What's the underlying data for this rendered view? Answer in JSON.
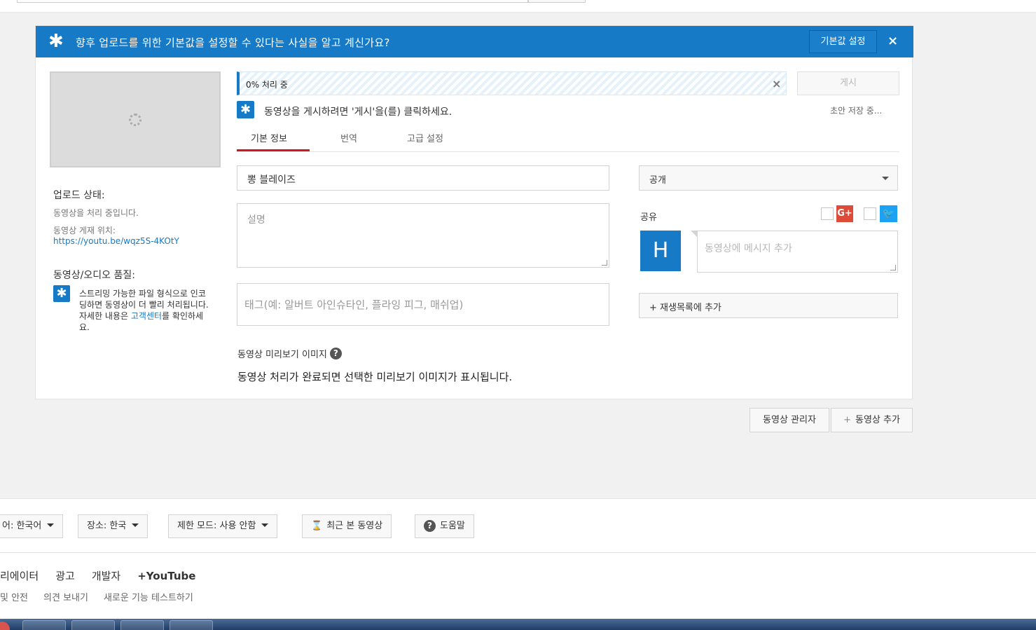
{
  "banner": {
    "text": "향후 업로드를 위한 기본값을 설정할 수 있다는 사실을 알고 계신가요?",
    "settings_button": "기본값 설정",
    "close": "×"
  },
  "left": {
    "status_heading": "업로드 상태:",
    "status_text": "동영상을 처리 중입니다.",
    "location_label": "동영상 게재 위치:",
    "location_url": "https://youtu.be/wqz5S-4KOtY",
    "quality_heading": "동영상/오디오 품질:",
    "quality_text_1": "스트리밍 가능한 파일 형식으로 인코딩하면 동영상이 더 빨리 처리됩니다. 자세한 내용은 ",
    "quality_link": "고객센터",
    "quality_text_2": "를 확인하세요."
  },
  "upload": {
    "progress_text": "0% 처리 중",
    "progress_percent": 0,
    "cancel": "×",
    "publish_button": "게시",
    "publish_hint": "동영상을 게시하려면 '게시'을(를) 클릭하세요.",
    "draft_status": "초안 저장 중..."
  },
  "tabs": [
    {
      "label": "기본 정보",
      "active": true
    },
    {
      "label": "번역",
      "active": false
    },
    {
      "label": "고급 설정",
      "active": false
    }
  ],
  "form": {
    "title_value": "뽕 블레이즈",
    "description_placeholder": "설명",
    "tags_placeholder": "태그(예: 알버트 아인슈타인, 플라잉 피그, 매쉬업)",
    "preview_label": "동영상 미리보기 이미지",
    "preview_help": "?",
    "preview_message": "동영상 처리가 완료되면 선택한 미리보기 이미지가 표시됩니다."
  },
  "share": {
    "visibility": "공개",
    "label": "공유",
    "gplus": "G+",
    "avatar_letter": "H",
    "message_placeholder": "동영상에 메시지 추가",
    "playlist_button": "+ 재생목록에 추가"
  },
  "actions": {
    "manager_button": "동영상 관리자",
    "add_button": "동영상 추가",
    "add_icon": "+"
  },
  "footer": {
    "language": "어: 한국어",
    "location": "장소: 한국",
    "restricted": "제한 모드: 사용 안함",
    "history": "최근 본 동영상",
    "help": "도움말",
    "links1": [
      "리에이터",
      "광고",
      "개발자",
      "+YouTube"
    ],
    "links2": [
      "및 안전",
      "의견 보내기",
      "새로운 기능 테스트하기"
    ]
  },
  "colors": {
    "accent": "#167ac6",
    "tab_active": "#cc181e",
    "gplus": "#dd4b39",
    "twitter": "#1da1f2"
  }
}
